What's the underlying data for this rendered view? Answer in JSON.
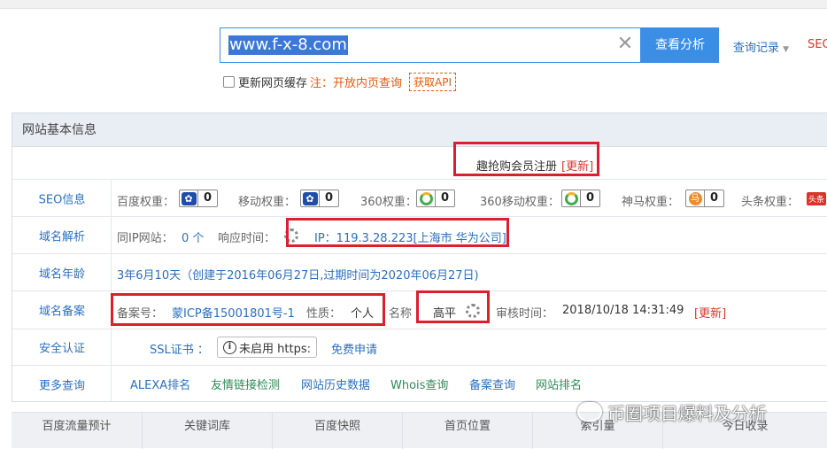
{
  "search": {
    "value": "www.f-x-8.com",
    "button": "查看分析",
    "clear_icon": "close-icon",
    "history_link": "查询记录",
    "seo_link": "SEO"
  },
  "options": {
    "checkbox_label": "更新网页缓存",
    "note": "注：开放内页查询",
    "api": "获取API"
  },
  "panel": {
    "title": "网站基本信息",
    "promo": {
      "text": "趣抢购会员注册",
      "update": "[更新]"
    },
    "seo": {
      "label": "SEO信息",
      "items": [
        {
          "name": "百度权重：",
          "icon": "baidu-paw-icon",
          "value": "0"
        },
        {
          "name": "移动权重：",
          "icon": "baidu-paw-icon",
          "value": "0"
        },
        {
          "name": "360权重：",
          "icon": "360-ring-icon",
          "value": "0"
        },
        {
          "name": "360移动权重：",
          "icon": "360-ring-icon",
          "value": "0"
        },
        {
          "name": "神马权重：",
          "icon": "shenma-icon",
          "value": "0"
        },
        {
          "name": "头条权重：",
          "icon": "toutiao-icon",
          "badge": "头条"
        }
      ]
    },
    "dns": {
      "label": "域名解析",
      "same_ip_label": "同IP网站：",
      "same_ip_value": "0 个",
      "response_label": "响应时间：",
      "ip": "IP：119.3.28.223[上海市 华为公司]"
    },
    "age": {
      "label": "域名年龄",
      "value": "3年6月10天（创建于2016年06月27日,过期时间为2020年06月27日)"
    },
    "icp": {
      "label": "域名备案",
      "no_label": "备案号：",
      "no_value": "蒙ICP备15001801号-1",
      "type_label": "性质：",
      "type_value": "个人",
      "name_label": "名称",
      "name_value": "高平",
      "audit_label": "审核时间：",
      "audit_value": "2018/10/18 14:31:49",
      "update": "[更新]"
    },
    "security": {
      "label": "安全认证",
      "ssl_label": "SSL证书 ：",
      "ssl_value": "未启用 https:",
      "apply": "免费申请"
    },
    "more": {
      "label": "更多查询",
      "links": [
        "ALEXA排名",
        "友情链接检测",
        "网站历史数据",
        "Whois查询",
        "备案查询",
        "网站排名"
      ]
    }
  },
  "bottom_tabs": [
    "百度流量预计",
    "关键词库",
    "百度快照",
    "首页位置",
    "索引量",
    "今日收录"
  ],
  "watermark": "币圈项目爆料及分析",
  "colors": {
    "accent": "#3a8ee6",
    "highlight": "#d9202b",
    "link": "#2b6fbf",
    "warning": "#e8590c"
  }
}
